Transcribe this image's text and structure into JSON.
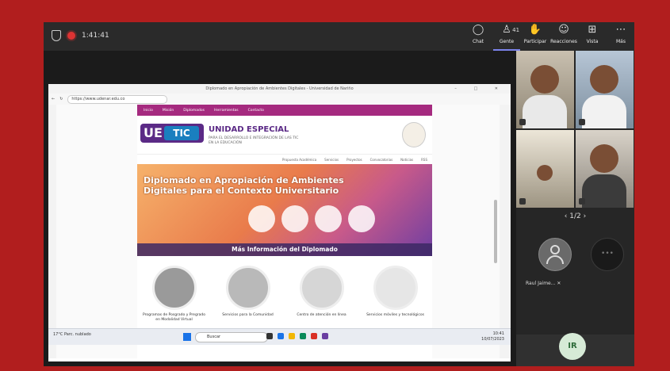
{
  "meeting": {
    "timer": "1:41:41",
    "toolbar": [
      {
        "label": "Chat",
        "icon": "chat-icon"
      },
      {
        "label": "Gente",
        "icon": "people-icon",
        "count": "41"
      },
      {
        "label": "Participar",
        "icon": "raise-hand-icon"
      },
      {
        "label": "Reacciones",
        "icon": "reactions-icon"
      },
      {
        "label": "Vista",
        "icon": "view-icon"
      },
      {
        "label": "Más",
        "icon": "more-icon"
      }
    ],
    "pager": "1/2",
    "participants": [
      {
        "name": "Raul Jaime..."
      }
    ],
    "self_initials": "IR"
  },
  "shared_browser": {
    "tab_title": "Diplomado en Apropiación de Ambientes Digitales - Universidad de Nariño",
    "url": "https://www.udenar.edu.co",
    "site": {
      "nav": [
        "Inicio",
        "Misión",
        "Diplomados",
        "Herramientas",
        "Contacto"
      ],
      "title": "UNIDAD ESPECIAL",
      "subtitle": "PARA EL DESARROLLO E INTEGRACIÓN DE LAS TIC EN LA EDUCACIÓN",
      "logo_u": "UE",
      "logo_tic": "TIC",
      "menu": [
        "Propuesta Académica",
        "Servicios",
        "Proyectos",
        "Convocatorias",
        "Noticias",
        "RSS"
      ],
      "banner_title": "Diplomado en Apropiación de Ambientes Digitales para el Contexto Universitario",
      "banner_button": "Más Información del Diplomado",
      "cards": [
        "Programas de Posgrado y Pregrado en Modalidad Virtual",
        "Servicios para la Comunidad",
        "Centro de atención en línea",
        "Servicios móviles y tecnológicos"
      ]
    },
    "taskbar": {
      "weather": "17°C Parc. nublado",
      "search_placeholder": "Buscar",
      "time": "10:41",
      "date": "10/07/2023"
    }
  }
}
